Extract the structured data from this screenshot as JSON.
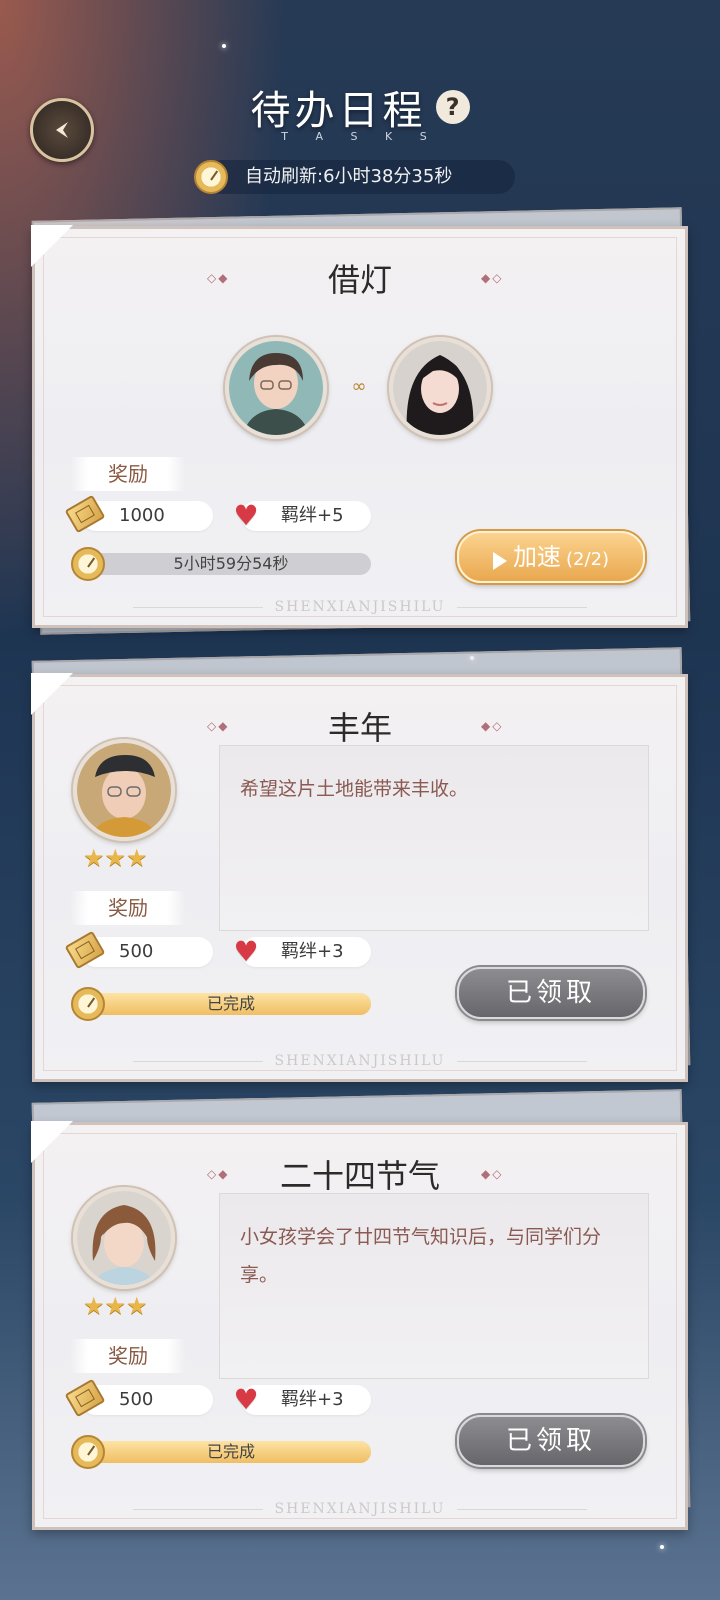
{
  "header": {
    "title": "待办日程",
    "subtitle": "T A S K S",
    "help": "?",
    "refresh_text": "自动刷新:6小时38分35秒"
  },
  "cards": [
    {
      "title": "借灯",
      "reward_label": "奖励",
      "currency": "1000",
      "bond": "羁绊+5",
      "timer": "5小时59分54秒",
      "progress": 0.0,
      "button_label": "加速",
      "button_count": "(2/2)",
      "watermark": "SHENXIANJISHILU"
    },
    {
      "title": "丰年",
      "description": "希望这片土地能带来丰收。",
      "stars": 3,
      "reward_label": "奖励",
      "currency": "500",
      "bond": "羁绊+3",
      "status": "已完成",
      "progress": 1.0,
      "button_label": "已领取",
      "watermark": "SHENXIANJISHILU"
    },
    {
      "title": "二十四节气",
      "description": "小女孩学会了廿四节气知识后，与同学们分享。",
      "stars": 3,
      "reward_label": "奖励",
      "currency": "500",
      "bond": "羁绊+3",
      "status": "已完成",
      "progress": 1.0,
      "button_label": "已领取",
      "watermark": "SHENXIANJISHILU"
    }
  ],
  "colors": {
    "accent": "#e9a84f",
    "heart": "#d83a45",
    "claimed": "#6f6f73"
  }
}
